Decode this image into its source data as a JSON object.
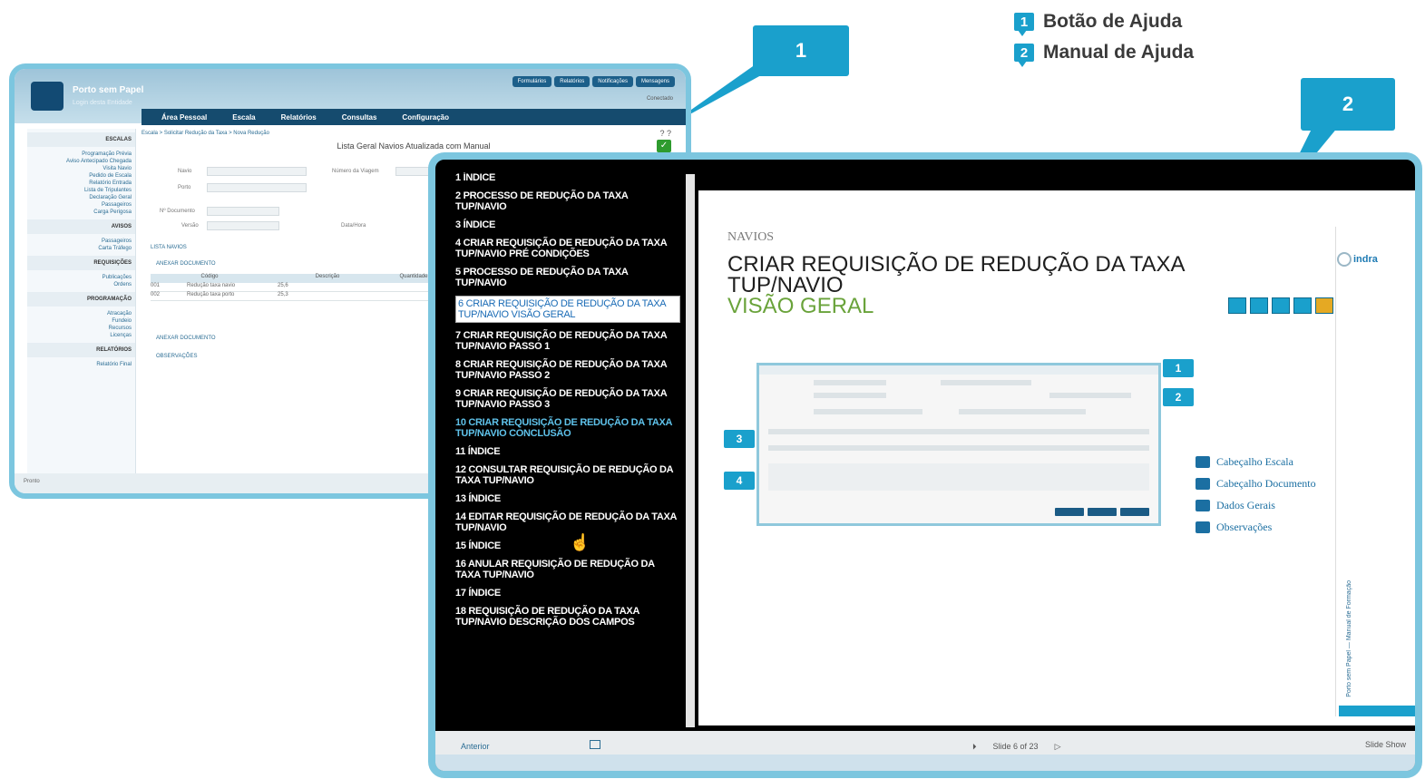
{
  "legend": [
    {
      "num": "1",
      "label": "Botão de Ajuda"
    },
    {
      "num": "2",
      "label": "Manual de Ajuda"
    }
  ],
  "callouts": {
    "one": "1",
    "two": "2"
  },
  "app": {
    "title": "Porto sem Papel",
    "subtitle": "Login desta Entidade",
    "top_tabs": [
      "Formulários",
      "Relatórios",
      "Notificações",
      "Mensagens"
    ],
    "status": "Conectado",
    "nav": [
      "Área Pessoal",
      "Escala",
      "Relatórios",
      "Consultas",
      "Configuração"
    ],
    "breadcrumb": "Escala > Solicitar Redução da Taxa > Nova Redução",
    "form_title": "Lista Geral Navios Atualizada com Manual",
    "help_icons": "? ?",
    "check": "✓",
    "sidebar": [
      {
        "type": "sec",
        "text": "ESCALAS"
      },
      {
        "type": "item",
        "text": "Programação Prévia"
      },
      {
        "type": "item",
        "text": "Aviso Antecipado Chegada"
      },
      {
        "type": "item",
        "text": "Visita Navio"
      },
      {
        "type": "item",
        "text": "Pedido de Escala"
      },
      {
        "type": "item",
        "text": "Relatório Entrada"
      },
      {
        "type": "item",
        "text": "Lista de Tripulantes"
      },
      {
        "type": "item",
        "text": "Declaração Geral"
      },
      {
        "type": "item",
        "text": "Passageiros"
      },
      {
        "type": "item",
        "text": "Carga Perigosa"
      },
      {
        "type": "sec",
        "text": "AVISOS"
      },
      {
        "type": "item",
        "text": "Passageiros"
      },
      {
        "type": "item",
        "text": "Carta Tráfego"
      },
      {
        "type": "sec",
        "text": "REQUISIÇÕES"
      },
      {
        "type": "item",
        "text": "Publicações"
      },
      {
        "type": "item",
        "text": "Ordens"
      },
      {
        "type": "sec",
        "text": "PROGRAMAÇÃO"
      },
      {
        "type": "item",
        "text": "Atracação"
      },
      {
        "type": "item",
        "text": "Fundeio"
      },
      {
        "type": "item",
        "text": "Recursos"
      },
      {
        "type": "item",
        "text": "Licenças"
      },
      {
        "type": "sec",
        "text": "RELATÓRIOS"
      },
      {
        "type": "item",
        "text": "Relatório Final"
      }
    ],
    "fields": {
      "navio": "Navio",
      "viagem": "Número da Viagem",
      "porto": "Porto",
      "documento": "Nº Documento",
      "versao": "Versão",
      "data": "Data/Hora"
    },
    "panels": {
      "lista": "LISTA NAVIOS",
      "anexar": "ANEXAR DOCUMENTO",
      "observacoes": "OBSERVAÇÕES"
    },
    "table": {
      "headers": [
        "Código",
        "Descrição",
        "Quantidade"
      ],
      "rows": [
        [
          "001",
          "Redução taxa navio",
          "25,6"
        ],
        [
          "002",
          "Redução taxa porto",
          "25,3"
        ]
      ]
    },
    "footer": "Pronto"
  },
  "help": {
    "toc": [
      {
        "text": "1 ÍNDICE",
        "style": "normal"
      },
      {
        "text": "2 PROCESSO DE REDUÇÃO DA TAXA TUP/NAVIO",
        "style": "normal"
      },
      {
        "text": "3 ÍNDICE",
        "style": "normal"
      },
      {
        "text": "4 CRIAR REQUISIÇÃO DE REDUÇÃO DA TAXA TUP/NAVIO PRÉ CONDIÇÕES",
        "style": "normal"
      },
      {
        "text": "5 PROCESSO DE REDUÇÃO DA TAXA TUP/NAVIO",
        "style": "normal"
      },
      {
        "text": "6 CRIAR REQUISIÇÃO DE REDUÇÃO DA TAXA TUP/NAVIO VISÃO GERAL",
        "style": "sel"
      },
      {
        "text": "7 CRIAR REQUISIÇÃO DE REDUÇÃO DA TAXA TUP/NAVIO PASSO 1",
        "style": "normal"
      },
      {
        "text": "8 CRIAR REQUISIÇÃO DE REDUÇÃO DA TAXA TUP/NAVIO PASSO 2",
        "style": "normal"
      },
      {
        "text": "9 CRIAR REQUISIÇÃO DE REDUÇÃO DA TAXA TUP/NAVIO PASSO 3",
        "style": "normal"
      },
      {
        "text": "10 CRIAR REQUISIÇÃO DE REDUÇÃO DA TAXA TUP/NAVIO CONCLUSÃO",
        "style": "blue"
      },
      {
        "text": "11 ÍNDICE",
        "style": "normal"
      },
      {
        "text": "12 CONSULTAR REQUISIÇÃO DE REDUÇÃO DA TAXA TUP/NAVIO",
        "style": "normal"
      },
      {
        "text": "13 ÍNDICE",
        "style": "normal"
      },
      {
        "text": "14 EDITAR REQUISIÇÃO DE REDUÇÃO DA TAXA TUP/NAVIO",
        "style": "normal"
      },
      {
        "text": "15 ÍNDICE",
        "style": "normal"
      },
      {
        "text": "16 ANULAR REQUISIÇÃO DE REDUÇÃO DA TAXA TUP/NAVIO",
        "style": "normal"
      },
      {
        "text": "17 ÍNDICE",
        "style": "normal"
      },
      {
        "text": "18 REQUISIÇÃO DE REDUÇÃO DA TAXA TUP/NAVIO DESCRIÇÃO DOS CAMPOS",
        "style": "normal"
      }
    ],
    "slide": {
      "kicker": "NAVIOS",
      "title_part1": "CRIAR",
      "title_part2": " REQUISIÇÃO DE REDUÇÃO DA TAXA",
      "title_part3": "TUP/NAVIO",
      "title_part4": "VISÃO GERAL",
      "brand": "indra",
      "side_vertical": "Porto sem Papel — Manual de Formação",
      "markers": [
        "1",
        "2",
        "3",
        "4"
      ],
      "side_list": [
        "Cabeçalho Escala",
        "Cabeçalho Documento",
        "Dados Gerais",
        "Observações"
      ]
    },
    "bottom": {
      "prev": "Anterior",
      "page": "Slide 6 of 23",
      "next": "▷",
      "play": "⏵",
      "right": "Slide Show"
    }
  },
  "colors": {
    "accent": "#1aa0cc",
    "frame": "#7cc6df",
    "nav": "#154b6e"
  }
}
